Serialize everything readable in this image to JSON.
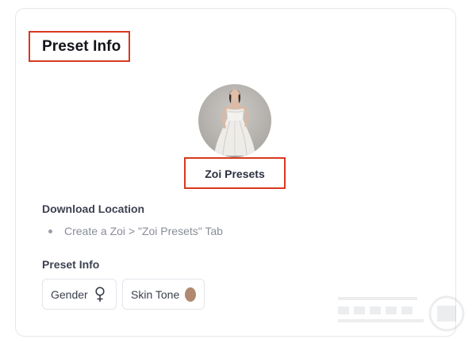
{
  "card": {
    "title": "Preset Info",
    "preset_name": "Zoi Presets",
    "download_location_label": "Download Location",
    "download_location_items": [
      "Create a Zoi > \"Zoi Presets\" Tab"
    ],
    "preset_info_label": "Preset Info",
    "chips": {
      "gender_label": "Gender",
      "gender_icon": "female-symbol-icon",
      "skin_tone_label": "Skin Tone",
      "skin_tone_color": "#b08a70"
    }
  },
  "colors": {
    "highlight": "#d9381e",
    "border": "#e6e7eb"
  }
}
